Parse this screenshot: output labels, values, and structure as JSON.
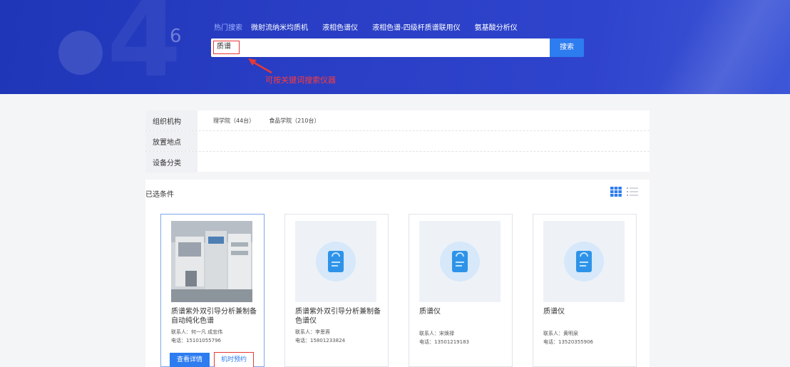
{
  "search": {
    "hot_label": "热门搜索",
    "hot_items": [
      "微射流纳米均质机",
      "液相色谱仪",
      "液相色谱-四级杆质谱联用仪",
      "氨基酸分析仪"
    ],
    "query": "质谱",
    "button": "搜索",
    "annotation": "可按关键词搜索仪器"
  },
  "filters": [
    {
      "label": "组织机构",
      "options": [
        "理学院（44台）",
        "食品学院（210台）"
      ]
    },
    {
      "label": "放置地点",
      "options": []
    },
    {
      "label": "设备分类",
      "options": []
    }
  ],
  "results": {
    "title": "已选条件",
    "cards": [
      {
        "name": "质谱紫外双引导分析兼制备自动纯化色谱",
        "contact": "联系人：何一凡 成忠伟",
        "phone": "电话：15101055796",
        "has_photo": true
      },
      {
        "name": "质谱紫外双引导分析兼制备色谱仪",
        "contact": "联系人：李思蓉",
        "phone": "电话：15801233824",
        "has_photo": false
      },
      {
        "name": "质谱仪",
        "contact": "联系人：宋焕禄",
        "phone": "电话：13501219183",
        "has_photo": false
      },
      {
        "name": "质谱仪",
        "contact": "联系人：黄明泉",
        "phone": "电话：13520355906",
        "has_photo": false
      }
    ],
    "detail_button": "查看详情",
    "book_button": "机时预约"
  },
  "colors": {
    "brand_blue": "#2d7cf0",
    "hero_blue": "#2a3fc6",
    "annotation_red": "#e53935"
  }
}
